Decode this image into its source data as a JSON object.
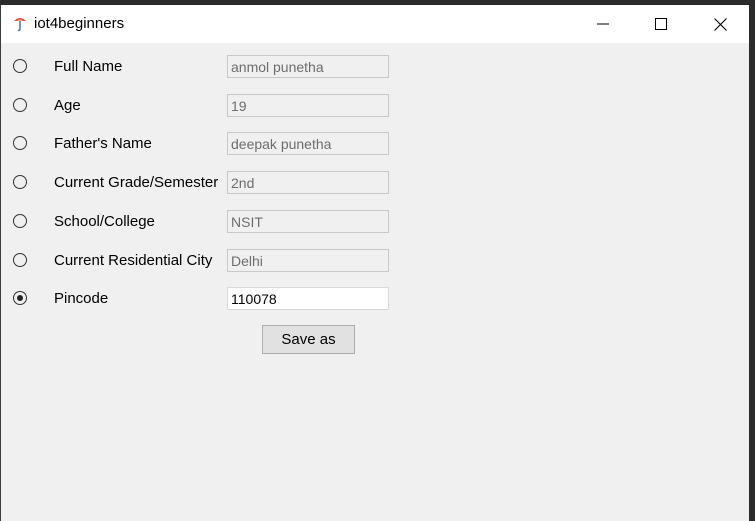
{
  "window": {
    "title": "iot4beginners"
  },
  "form": {
    "rows": [
      {
        "label": "Full Name",
        "value": "anmol punetha",
        "selected": false
      },
      {
        "label": "Age",
        "value": "19",
        "selected": false
      },
      {
        "label": "Father's Name",
        "value": "deepak punetha",
        "selected": false
      },
      {
        "label": "Current Grade/Semester",
        "value": "2nd",
        "selected": false
      },
      {
        "label": "School/College",
        "value": "NSIT",
        "selected": false
      },
      {
        "label": "Current Residential City",
        "value": "Delhi",
        "selected": false
      },
      {
        "label": "Pincode",
        "value": "110078",
        "selected": true
      }
    ],
    "save_label": "Save as"
  },
  "colors": {
    "window_bg": "#f0f0f0",
    "titlebar_bg": "#ffffff",
    "disabled_text": "#6d6d6d"
  }
}
